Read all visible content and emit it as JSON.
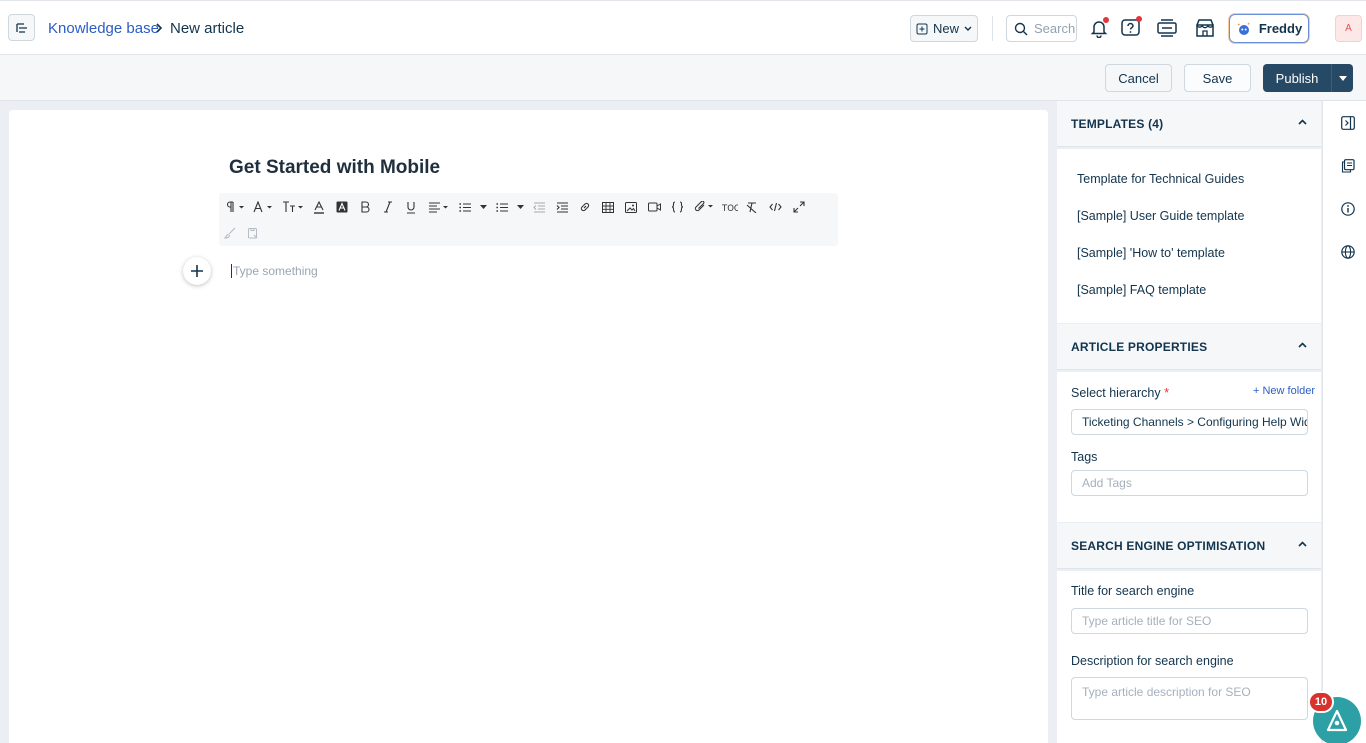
{
  "header": {
    "breadcrumb_root": "Knowledge base",
    "breadcrumb_current": "New article",
    "new_label": "New",
    "search_placeholder": "Search",
    "freddy_label": "Freddy",
    "avatar_initial": "A"
  },
  "actions": {
    "cancel_label": "Cancel",
    "save_label": "Save",
    "publish_label": "Publish"
  },
  "editor": {
    "title": "Get Started with Mobile",
    "body_placeholder": "Type something"
  },
  "templates": {
    "heading": "TEMPLATES (4)",
    "items": [
      "Template for Technical Guides",
      "[Sample] User Guide template",
      "[Sample] 'How to' template",
      "[Sample] FAQ template"
    ]
  },
  "properties": {
    "heading": "ARTICLE PROPERTIES",
    "hierarchy_label": "Select hierarchy",
    "required_mark": "*",
    "new_folder_label": "+ New folder",
    "hierarchy_value": "Ticketing Channels > Configuring Help Widget",
    "tags_label": "Tags",
    "tags_placeholder": "Add Tags"
  },
  "seo": {
    "heading": "SEARCH ENGINE OPTIMISATION",
    "title_label": "Title for search engine",
    "title_placeholder": "Type article title for SEO",
    "description_label": "Description for search engine",
    "description_placeholder": "Type article description for SEO"
  },
  "fab": {
    "badge_count": "10"
  },
  "colors": {
    "link": "#2c5cc5",
    "primary": "#264966",
    "badge": "#d7322e",
    "fab": "#2ca0a5"
  }
}
